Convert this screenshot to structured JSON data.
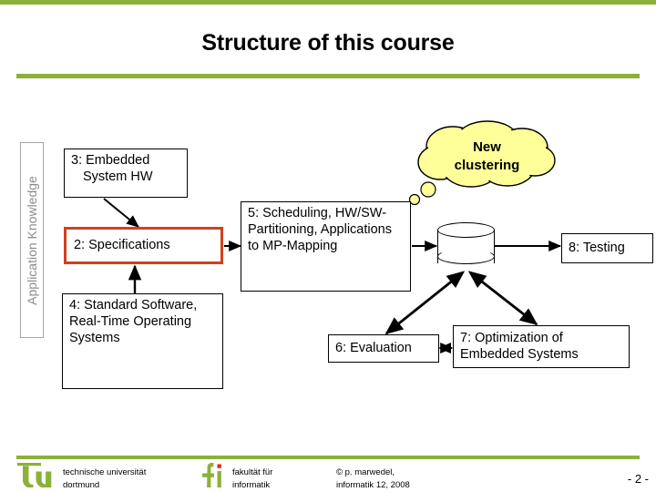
{
  "slide": {
    "title": "Structure of this course",
    "accent_green": "#8CB139",
    "highlight_orange": "#D2401E",
    "cloud_yellow": "#FFFF99"
  },
  "sidebar": {
    "label": "Application Knowledge"
  },
  "diagram": {
    "box3": {
      "line1": "3: Embedded",
      "line2": "System HW"
    },
    "box2": {
      "label": "2: Specifications"
    },
    "box4": {
      "label": "4: Standard Software, Real-Time Operating Systems"
    },
    "box5": {
      "label": "5: Scheduling, HW/SW-Partitioning, Applications to MP-Mapping"
    },
    "box6": {
      "label": "6: Evaluation"
    },
    "box7": {
      "label": "7: Optimization of Embedded Systems"
    },
    "box8": {
      "label": "8: Testing"
    },
    "cloud": {
      "line1": "New",
      "line2": "clustering"
    },
    "cylinder": {
      "name": "database-cylinder"
    }
  },
  "footer": {
    "tu_logo_text": "tu",
    "tu_line1": "technische universität",
    "tu_line2": "dortmund",
    "fi_logo_text": "fi",
    "fi_line1": "fakultät für",
    "fi_line2": "informatik",
    "copyright_line1": "© p. marwedel,",
    "copyright_line2": "informatik 12,  2008",
    "page_number": "- 2 -"
  }
}
